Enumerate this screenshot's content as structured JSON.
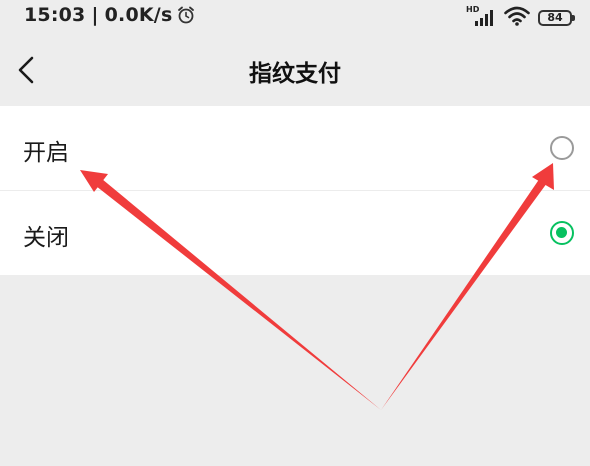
{
  "status_bar": {
    "time": "15:03",
    "network_speed": "0.0K/s",
    "separator": "|",
    "alarm_icon": "alarm-clock-icon",
    "signal_label": "HD",
    "battery_level": "84",
    "signal_icon": "cellular-signal-icon",
    "wifi_icon": "wifi-icon"
  },
  "nav": {
    "back_icon": "chevron-left-icon",
    "title": "指纹支付"
  },
  "options": [
    {
      "label": "开启",
      "selected": false
    },
    {
      "label": "关闭",
      "selected": true
    }
  ],
  "colors": {
    "accent": "#07c160",
    "annotation": "#f03c3c",
    "background": "#ededed"
  }
}
